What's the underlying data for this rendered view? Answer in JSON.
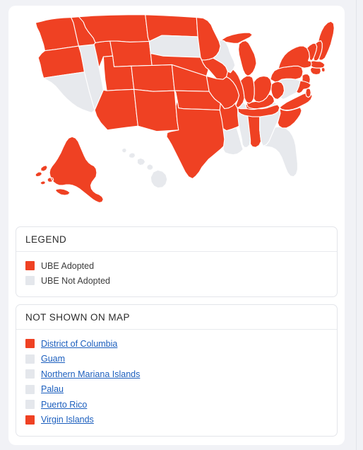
{
  "page": {
    "background_color": "#f1f2f6",
    "card_background": "#ffffff"
  },
  "colors": {
    "adopted": "#ef4123",
    "not_adopted": "#e7e9ed",
    "link": "#1c5fbe",
    "border": "#e3e5ea"
  },
  "map": {
    "name": "united-states-choropleth",
    "adopted_label": "UBE Adopted",
    "not_adopted_label": "UBE Not Adopted",
    "not_adopted_states": [
      "California",
      "Nevada",
      "South Dakota",
      "Wisconsin",
      "Virginia",
      "Georgia",
      "Florida",
      "Mississippi",
      "Louisiana",
      "Hawaii"
    ],
    "adopted_states": [
      "Alabama",
      "Alaska",
      "Arizona",
      "Arkansas",
      "Colorado",
      "Connecticut",
      "Delaware",
      "Idaho",
      "Illinois",
      "Indiana",
      "Iowa",
      "Kansas",
      "Kentucky",
      "Maine",
      "Maryland",
      "Massachusetts",
      "Michigan",
      "Minnesota",
      "Missouri",
      "Montana",
      "Nebraska",
      "New Hampshire",
      "New Jersey",
      "New Mexico",
      "New York",
      "North Carolina",
      "North Dakota",
      "Ohio",
      "Oklahoma",
      "Oregon",
      "Pennsylvania",
      "Rhode Island",
      "South Carolina",
      "Tennessee",
      "Texas",
      "Utah",
      "Vermont",
      "Washington",
      "West Virginia",
      "Wyoming"
    ]
  },
  "legend": {
    "title": "LEGEND",
    "items": [
      {
        "label": "UBE Adopted",
        "status": "adopted"
      },
      {
        "label": "UBE Not Adopted",
        "status": "not-adopted"
      }
    ]
  },
  "not_shown": {
    "title": "NOT SHOWN ON MAP",
    "items": [
      {
        "label": "District of Columbia",
        "status": "adopted"
      },
      {
        "label": "Guam",
        "status": "not-adopted"
      },
      {
        "label": "Northern Mariana Islands",
        "status": "not-adopted"
      },
      {
        "label": "Palau",
        "status": "not-adopted"
      },
      {
        "label": "Puerto Rico",
        "status": "not-adopted"
      },
      {
        "label": "Virgin Islands",
        "status": "adopted"
      }
    ]
  }
}
